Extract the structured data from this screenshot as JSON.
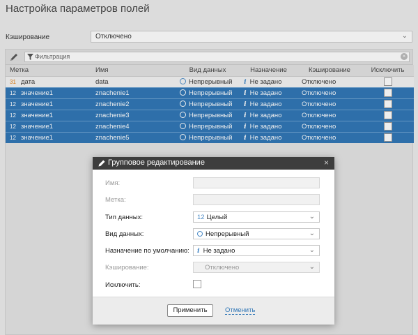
{
  "page": {
    "title": "Настройка параметров полей"
  },
  "caching": {
    "label": "Кэширование",
    "value": "Отключено"
  },
  "filter": {
    "placeholder": "Фильтрация"
  },
  "table": {
    "headers": [
      "Метка",
      "Имя",
      "Вид данных",
      "Назначение",
      "Кэширование",
      "Исключить"
    ],
    "rows": [
      {
        "type": "31",
        "label": "дата",
        "name": "data",
        "kind": "Непрерывный",
        "purpose": "Не задано",
        "caching": "Отключено",
        "selected": false
      },
      {
        "type": "12",
        "label": "значение1",
        "name": "znachenie1",
        "kind": "Непрерывный",
        "purpose": "Не задано",
        "caching": "Отключено",
        "selected": true
      },
      {
        "type": "12",
        "label": "значение1",
        "name": "znachenie2",
        "kind": "Непрерывный",
        "purpose": "Не задано",
        "caching": "Отключено",
        "selected": true
      },
      {
        "type": "12",
        "label": "значение1",
        "name": "znachenie3",
        "kind": "Непрерывный",
        "purpose": "Не задано",
        "caching": "Отключено",
        "selected": true
      },
      {
        "type": "12",
        "label": "значение1",
        "name": "znachenie4",
        "kind": "Непрерывный",
        "purpose": "Не задано",
        "caching": "Отключено",
        "selected": true
      },
      {
        "type": "12",
        "label": "значение1",
        "name": "znachenie5",
        "kind": "Непрерывный",
        "purpose": "Не задано",
        "caching": "Отключено",
        "selected": true
      }
    ]
  },
  "dialog": {
    "title": "Групповое редактирование",
    "name_label": "Имя:",
    "label_label": "Метка:",
    "type_label": "Тип данных:",
    "type_badge": "12",
    "type_value": "Целый",
    "kind_label": "Вид данных:",
    "kind_value": "Непрерывный",
    "purpose_label": "Назначение по умолчанию:",
    "purpose_value": "Не задано",
    "caching_label": "Кэширование:",
    "caching_value": "Отключено",
    "exclude_label": "Исключить:",
    "apply_label": "Применить",
    "cancel_label": "Отменить"
  },
  "colors": {
    "selected_row": "#2f76b6",
    "accent": "#4d8cc7",
    "date_icon": "#e27d10",
    "dialog_header": "#3d3d3d"
  }
}
